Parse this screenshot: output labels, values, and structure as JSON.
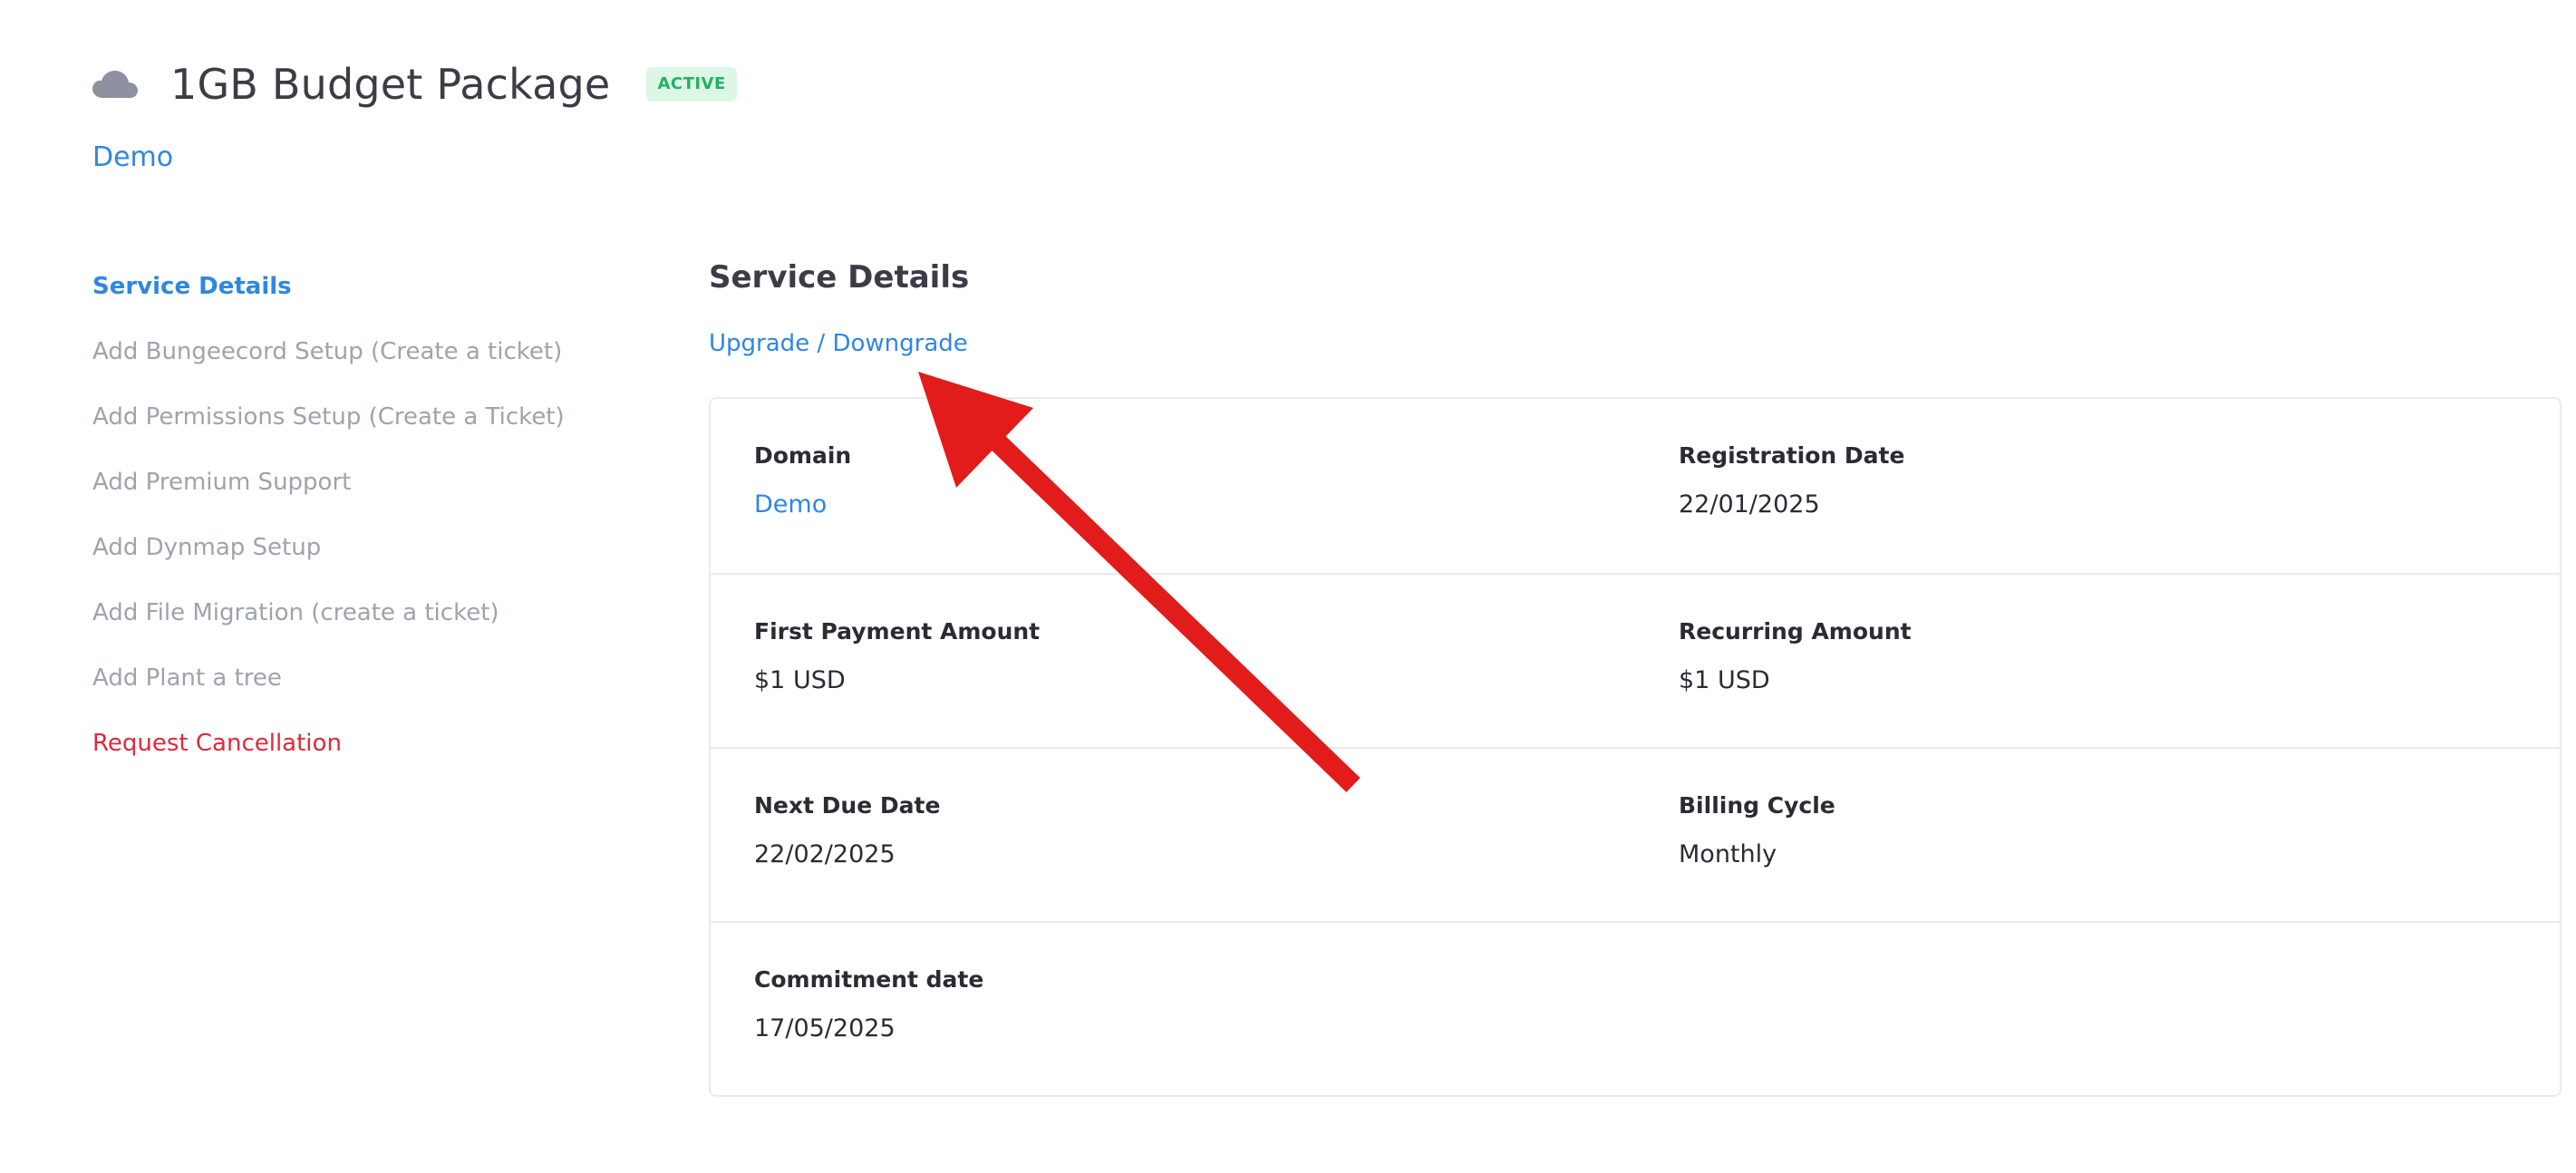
{
  "header": {
    "icon": "cloud-icon",
    "title": "1GB Budget Package",
    "status": "ACTIVE",
    "domain_link": "Demo"
  },
  "colors": {
    "accent": "#2f86e3",
    "danger": "#e0293a",
    "badge_bg": "#dcf7e6",
    "badge_text": "#25b064",
    "muted": "#9ea3ad",
    "annotation": "#e21b1b"
  },
  "sidebar": {
    "items": [
      {
        "label": "Service Details"
      },
      {
        "label": "Add Bungeecord Setup (Create a ticket)"
      },
      {
        "label": "Add Permissions Setup (Create a Ticket)"
      },
      {
        "label": "Add Premium Support"
      },
      {
        "label": "Add Dynmap Setup"
      },
      {
        "label": "Add File Migration (create a ticket)"
      },
      {
        "label": "Add Plant a tree"
      },
      {
        "label": "Request Cancellation"
      }
    ]
  },
  "main": {
    "section_title": "Service Details",
    "upgrade_link": "Upgrade / Downgrade",
    "fields": {
      "domain": {
        "label": "Domain",
        "value": "Demo"
      },
      "registration_date": {
        "label": "Registration Date",
        "value": "22/01/2025"
      },
      "first_payment": {
        "label": "First Payment Amount",
        "value": "$1 USD"
      },
      "recurring": {
        "label": "Recurring Amount",
        "value": "$1 USD"
      },
      "next_due": {
        "label": "Next Due Date",
        "value": "22/02/2025"
      },
      "billing_cycle": {
        "label": "Billing Cycle",
        "value": "Monthly"
      },
      "commitment": {
        "label": "Commitment date",
        "value": "17/05/2025"
      }
    }
  }
}
